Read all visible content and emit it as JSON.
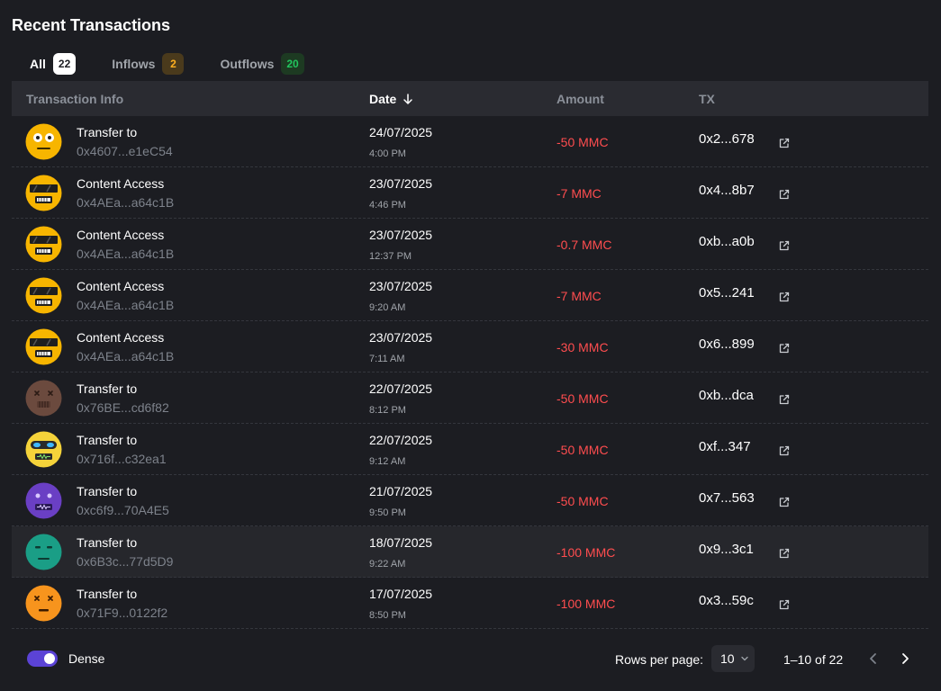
{
  "title": "Recent Transactions",
  "tabs": [
    {
      "label": "All",
      "count": "22"
    },
    {
      "label": "Inflows",
      "count": "2"
    },
    {
      "label": "Outflows",
      "count": "20"
    }
  ],
  "columns": {
    "info": "Transaction Info",
    "date": "Date",
    "amount": "Amount",
    "tx": "TX"
  },
  "rows": [
    {
      "avatar": "yellow-sleepy",
      "title": "Transfer to",
      "address": "0x4607...e1eC54",
      "date": "24/07/2025",
      "time": "4:00 PM",
      "amount": "-50 MMC",
      "tx": "0x2...678"
    },
    {
      "avatar": "yellow-shades",
      "title": "Content Access",
      "address": "0x4AEa...a64c1B",
      "date": "23/07/2025",
      "time": "4:46 PM",
      "amount": "-7 MMC",
      "tx": "0x4...8b7"
    },
    {
      "avatar": "yellow-shades",
      "title": "Content Access",
      "address": "0x4AEa...a64c1B",
      "date": "23/07/2025",
      "time": "12:37 PM",
      "amount": "-0.7 MMC",
      "tx": "0xb...a0b"
    },
    {
      "avatar": "yellow-shades",
      "title": "Content Access",
      "address": "0x4AEa...a64c1B",
      "date": "23/07/2025",
      "time": "9:20 AM",
      "amount": "-7 MMC",
      "tx": "0x5...241"
    },
    {
      "avatar": "yellow-shades",
      "title": "Content Access",
      "address": "0x4AEa...a64c1B",
      "date": "23/07/2025",
      "time": "7:11 AM",
      "amount": "-30 MMC",
      "tx": "0x6...899"
    },
    {
      "avatar": "brown-x",
      "title": "Transfer to",
      "address": "0x76BE...cd6f82",
      "date": "22/07/2025",
      "time": "8:12 PM",
      "amount": "-50 MMC",
      "tx": "0xb...dca"
    },
    {
      "avatar": "yellow-robot",
      "title": "Transfer to",
      "address": "0x716f...c32ea1",
      "date": "22/07/2025",
      "time": "9:12 AM",
      "amount": "-50 MMC",
      "tx": "0xf...347"
    },
    {
      "avatar": "purple-zip",
      "title": "Transfer to",
      "address": "0xc6f9...70A4E5",
      "date": "21/07/2025",
      "time": "9:50 PM",
      "amount": "-50 MMC",
      "tx": "0x7...563"
    },
    {
      "avatar": "teal-flat",
      "title": "Transfer to",
      "address": "0x6B3c...77d5D9",
      "date": "18/07/2025",
      "time": "9:22 AM",
      "amount": "-100 MMC",
      "tx": "0x9...3c1"
    },
    {
      "avatar": "orange-x",
      "title": "Transfer to",
      "address": "0x71F9...0122f2",
      "date": "17/07/2025",
      "time": "8:50 PM",
      "amount": "-100 MMC",
      "tx": "0x3...59c"
    }
  ],
  "footer": {
    "dense_label": "Dense",
    "dense_on": true,
    "rows_per_page_label": "Rows per page:",
    "rows_per_page": "10",
    "range": "1–10 of 22"
  },
  "colors": {
    "accent": "#5b43d6",
    "negative": "#ff4d4f",
    "inflow_badge": "#ffb020",
    "outflow_badge": "#22c55e"
  },
  "icons": {
    "sort": "arrow-down-icon",
    "external": "external-link-icon",
    "prev": "chevron-left-icon",
    "next": "chevron-right-icon",
    "select": "chevron-down-icon"
  }
}
